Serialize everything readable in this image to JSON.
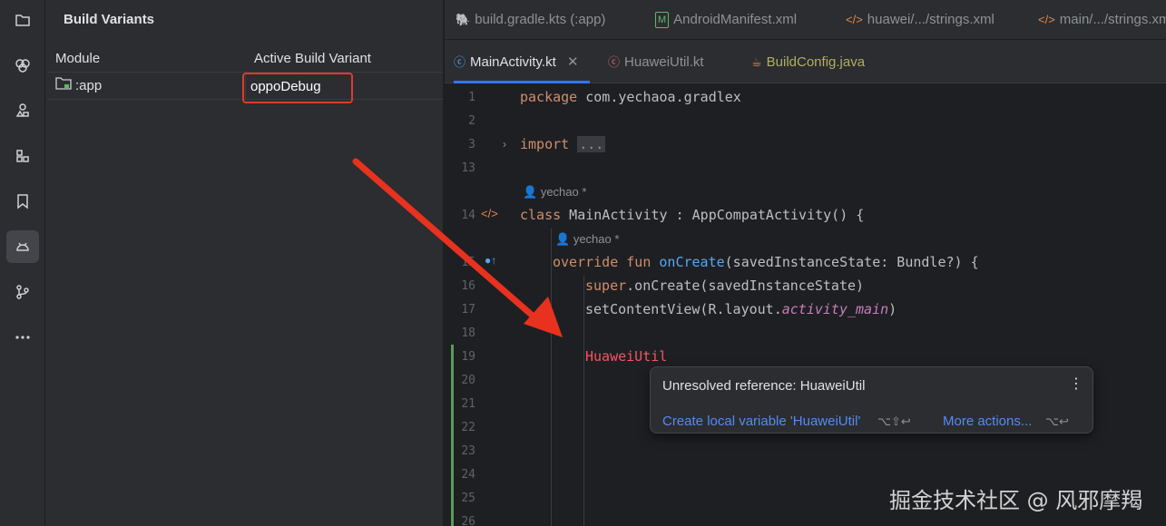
{
  "build_variants": {
    "title": "Build Variants",
    "col_module": "Module",
    "col_variant": "Active Build Variant",
    "rows": [
      {
        "module": ":app",
        "variant": "oppoDebug"
      }
    ]
  },
  "tabs_top": [
    {
      "label": "build.gradle.kts (:app)",
      "icon": "gradle-icon"
    },
    {
      "label": "AndroidManifest.xml",
      "icon": "manifest-icon"
    },
    {
      "label": "huawei/.../strings.xml",
      "icon": "xml-icon"
    },
    {
      "label": "main/.../strings.xm",
      "icon": "xml-icon"
    }
  ],
  "tabs_second": [
    {
      "label": "MainActivity.kt",
      "icon": "kotlin-class-icon",
      "active": true
    },
    {
      "label": "HuaweiUtil.kt",
      "icon": "kotlin-class-icon",
      "active": false
    },
    {
      "label": "BuildConfig.java",
      "icon": "java-icon",
      "active": false
    }
  ],
  "editor": {
    "line_numbers": [
      "1",
      "2",
      "3",
      "13",
      "14",
      "15",
      "16",
      "17",
      "18",
      "19",
      "20",
      "21",
      "22",
      "23",
      "24",
      "25",
      "26"
    ],
    "author1": "yechao *",
    "author2": "yechao *",
    "lines": {
      "l1_kw": "package",
      "l1_rest": " com.yechaoa.gradlex",
      "l3_kw": "import",
      "l3_fold": "...",
      "l14_kw": "class",
      "l14_rest": " MainActivity : AppCompatActivity() {",
      "l15_kw1": "override",
      "l15_kw2": "fun",
      "l15_fn": "onCreate",
      "l15_rest": "(savedInstanceState: Bundle?) {",
      "l16_kw": "super",
      "l16_rest": ".onCreate(savedInstanceState)",
      "l17_a": "setContentView(R.layout.",
      "l17_b": "activity_main",
      "l17_c": ")",
      "l19_err": "HuaweiUtil"
    }
  },
  "popup": {
    "message": "Unresolved reference: HuaweiUtil",
    "action1": "Create local variable 'HuaweiUtil'",
    "shortcut1": "⌥⇧↩",
    "action2": "More actions...",
    "shortcut2": "⌥↩"
  },
  "watermark": "掘金技术社区 @ 风邪摩羯",
  "colors": {
    "accent": "#3574f0",
    "highlight_box": "#e03a2a",
    "arrow": "#e8321f"
  }
}
